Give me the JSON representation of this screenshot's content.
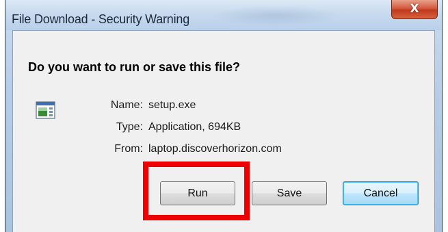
{
  "window": {
    "title": "File Download - Security Warning",
    "close_icon": "close-icon",
    "close_glyph": "X"
  },
  "dialog": {
    "question": "Do you want to run or save this file?",
    "file_icon": "application-file-icon",
    "details": [
      {
        "label": "Name:",
        "value": "setup.exe"
      },
      {
        "label": "Type:",
        "value": "Application, 694KB"
      },
      {
        "label": "From:",
        "value": "laptop.discoverhorizon.com"
      }
    ]
  },
  "buttons": {
    "run": "Run",
    "save": "Save",
    "cancel": "Cancel"
  },
  "annotation": {
    "highlight_color": "#ee0000",
    "highlighted": "run-button"
  },
  "colors": {
    "close_button": "#c0391d",
    "default_button_border": "#3c7fb1",
    "dialog_background": "#f0f0f0"
  }
}
